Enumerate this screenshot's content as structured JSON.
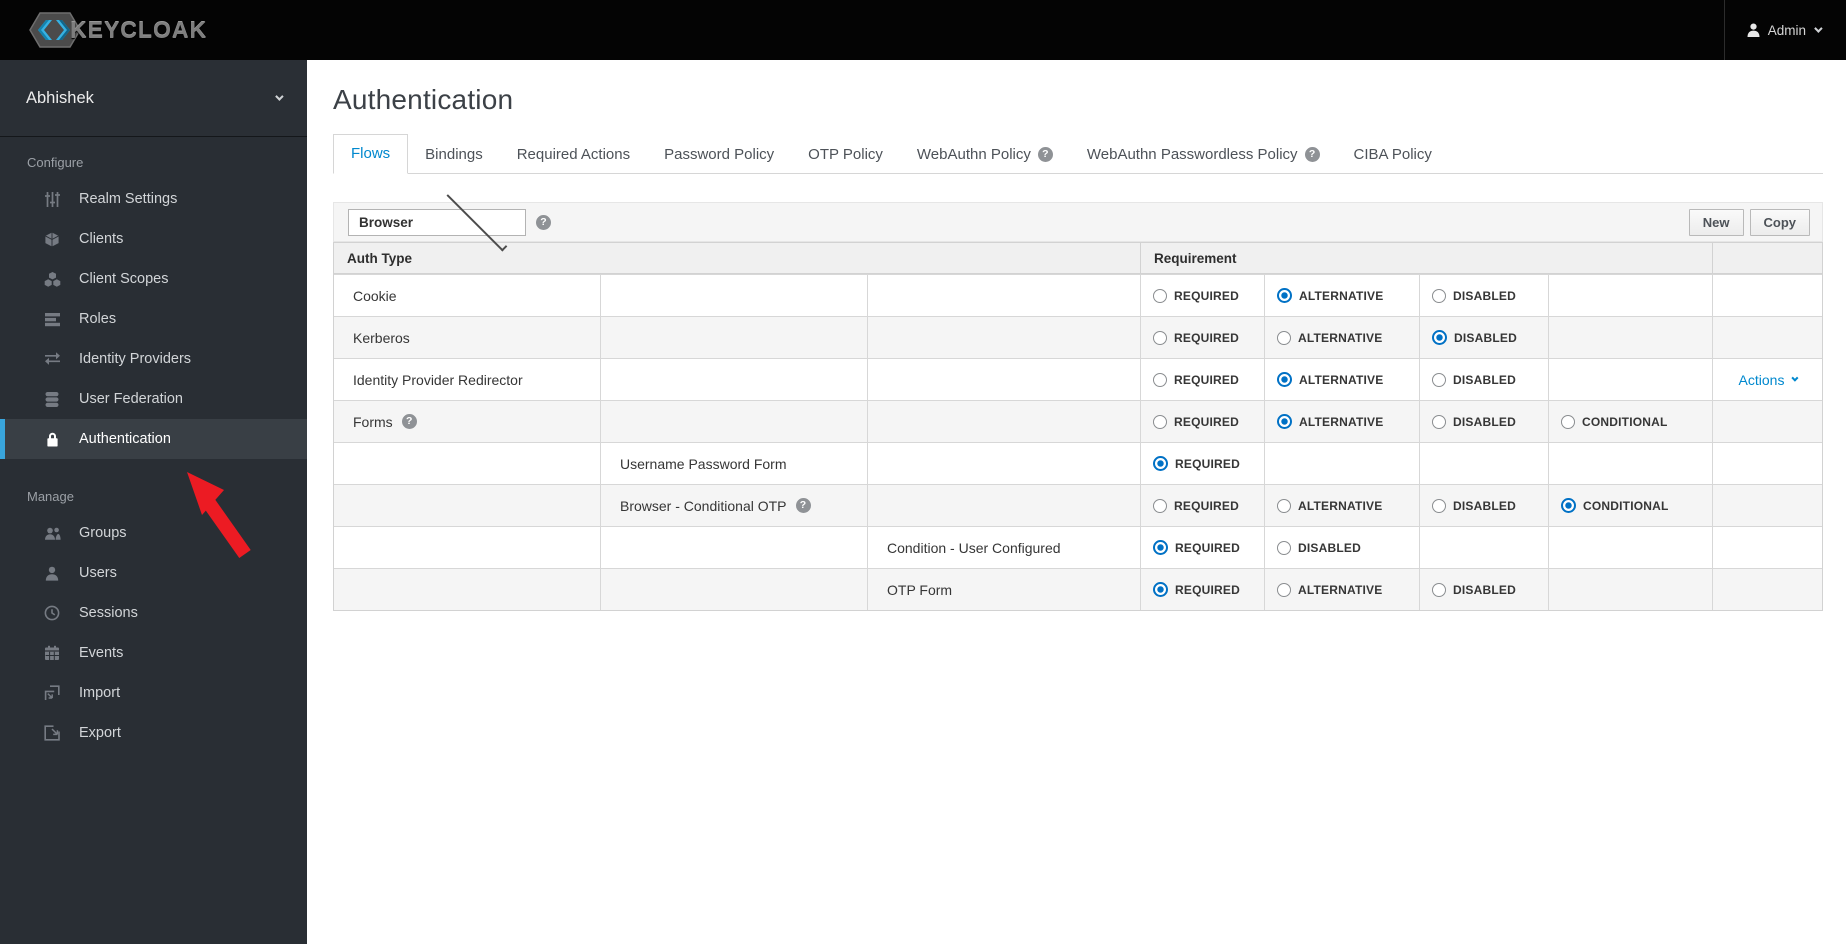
{
  "navbar": {
    "logo_text": "KEYCLOAK",
    "user_label": "Admin"
  },
  "sidebar": {
    "realm": "Abhishek",
    "sections": [
      {
        "label": "Configure",
        "items": [
          {
            "label": "Realm Settings"
          },
          {
            "label": "Clients"
          },
          {
            "label": "Client Scopes"
          },
          {
            "label": "Roles"
          },
          {
            "label": "Identity Providers"
          },
          {
            "label": "User Federation"
          },
          {
            "label": "Authentication",
            "active": true
          }
        ]
      },
      {
        "label": "Manage",
        "items": [
          {
            "label": "Groups"
          },
          {
            "label": "Users"
          },
          {
            "label": "Sessions"
          },
          {
            "label": "Events"
          },
          {
            "label": "Import"
          },
          {
            "label": "Export"
          }
        ]
      }
    ]
  },
  "page": {
    "title": "Authentication"
  },
  "tabs": [
    {
      "label": "Flows",
      "active": true
    },
    {
      "label": "Bindings"
    },
    {
      "label": "Required Actions"
    },
    {
      "label": "Password Policy"
    },
    {
      "label": "OTP Policy"
    },
    {
      "label": "WebAuthn Policy",
      "help": true
    },
    {
      "label": "WebAuthn Passwordless Policy",
      "help": true
    },
    {
      "label": "CIBA Policy"
    }
  ],
  "toolbar": {
    "flow_selected": "Browser",
    "new_label": "New",
    "copy_label": "Copy"
  },
  "table": {
    "headers": {
      "auth_type": "Auth Type",
      "requirement": "Requirement"
    },
    "rows": [
      {
        "label": "Cookie",
        "level": 0,
        "options": [
          {
            "label": "REQUIRED",
            "selected": false
          },
          {
            "label": "ALTERNATIVE",
            "selected": true
          },
          {
            "label": "DISABLED",
            "selected": false
          }
        ]
      },
      {
        "label": "Kerberos",
        "level": 0,
        "options": [
          {
            "label": "REQUIRED",
            "selected": false
          },
          {
            "label": "ALTERNATIVE",
            "selected": false
          },
          {
            "label": "DISABLED",
            "selected": true
          }
        ]
      },
      {
        "label": "Identity Provider Redirector",
        "level": 0,
        "actions_label": "Actions",
        "options": [
          {
            "label": "REQUIRED",
            "selected": false
          },
          {
            "label": "ALTERNATIVE",
            "selected": true
          },
          {
            "label": "DISABLED",
            "selected": false
          }
        ]
      },
      {
        "label": "Forms",
        "level": 0,
        "help": true,
        "options": [
          {
            "label": "REQUIRED",
            "selected": false
          },
          {
            "label": "ALTERNATIVE",
            "selected": true
          },
          {
            "label": "DISABLED",
            "selected": false
          },
          {
            "label": "CONDITIONAL",
            "selected": false
          }
        ]
      },
      {
        "label": "Username Password Form",
        "level": 1,
        "options": [
          {
            "label": "REQUIRED",
            "selected": true
          }
        ]
      },
      {
        "label": "Browser - Conditional OTP",
        "level": 1,
        "help": true,
        "options": [
          {
            "label": "REQUIRED",
            "selected": false
          },
          {
            "label": "ALTERNATIVE",
            "selected": false
          },
          {
            "label": "DISABLED",
            "selected": false
          },
          {
            "label": "CONDITIONAL",
            "selected": true
          }
        ]
      },
      {
        "label": "Condition - User Configured",
        "level": 2,
        "options": [
          {
            "label": "REQUIRED",
            "selected": true
          },
          {
            "label": "DISABLED",
            "selected": false
          }
        ]
      },
      {
        "label": "OTP Form",
        "level": 2,
        "options": [
          {
            "label": "REQUIRED",
            "selected": true
          },
          {
            "label": "ALTERNATIVE",
            "selected": false
          },
          {
            "label": "DISABLED",
            "selected": false
          }
        ]
      }
    ]
  },
  "colors": {
    "accent_blue": "#0088ce",
    "radio_selected": "#0071c5",
    "active_nav_bar": "#39a5dc",
    "annotation_red": "#ec1b23",
    "sidebar_bg": "#292e34",
    "navbar_bg": "#040404"
  },
  "help_icon_glyph": "?"
}
